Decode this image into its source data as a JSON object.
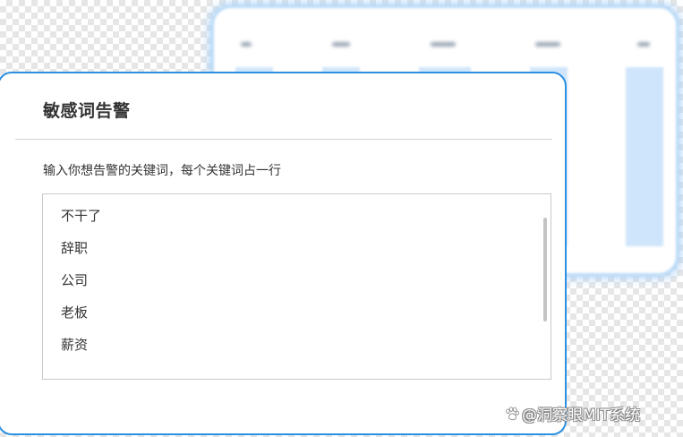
{
  "dialog": {
    "title": "敏感词告警",
    "instruction": "输入你想告警的关键词，每个关键词占一行",
    "keywords": [
      "不干了",
      "辞职",
      "公司",
      "老板",
      "薪资"
    ]
  },
  "watermark": {
    "text": "@洞察眼MIT系统",
    "icon": "paw-icon"
  },
  "colors": {
    "dialog_border": "#2d8fe0",
    "background_card_border": "#bcdcf8",
    "background_bar": "#cfe5fb"
  }
}
